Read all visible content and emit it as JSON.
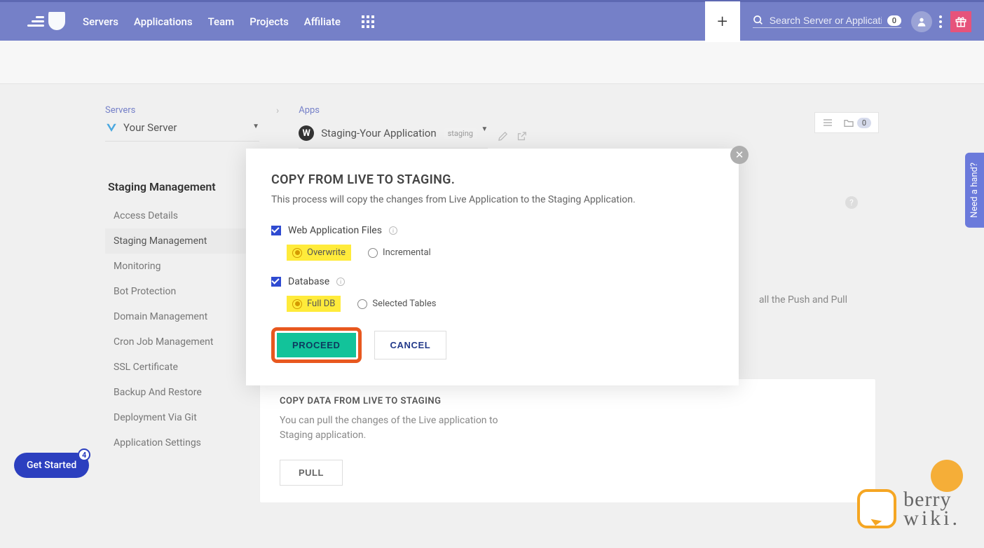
{
  "nav": {
    "links": [
      "Servers",
      "Applications",
      "Team",
      "Projects",
      "Affiliate"
    ],
    "search_placeholder": "Search Server or Application",
    "search_badge": "0"
  },
  "breadcrumb": {
    "servers_label": "Servers",
    "server_name": "Your Server",
    "apps_label": "Apps",
    "app_name": "Staging-Your Application",
    "app_tag": "staging"
  },
  "view_toggle_badge": "0",
  "sidebar": {
    "title": "Staging Management",
    "items": [
      {
        "label": "Access Details"
      },
      {
        "label": "Staging Management",
        "active": true
      },
      {
        "label": "Monitoring",
        "expandable": true
      },
      {
        "label": "Bot Protection"
      },
      {
        "label": "Domain Management"
      },
      {
        "label": "Cron Job Management"
      },
      {
        "label": "SSL Certificate"
      },
      {
        "label": "Backup And Restore"
      },
      {
        "label": "Deployment Via Git"
      },
      {
        "label": "Application Settings"
      }
    ]
  },
  "modal": {
    "title": "COPY FROM LIVE TO STAGING.",
    "desc": "This process will copy the changes from Live Application to the Staging Application.",
    "opt1_label": "Web Application Files",
    "opt1_radio1": "Overwrite",
    "opt1_radio2": "Incremental",
    "opt2_label": "Database",
    "opt2_radio1": "Full DB",
    "opt2_radio2": "Selected Tables",
    "proceed": "PROCEED",
    "cancel": "CANCEL"
  },
  "bg_panel": {
    "title": "COPY DATA FROM LIVE TO STAGING",
    "desc": "You can pull the changes of the Live application to Staging application.",
    "pull": "PULL",
    "right_text": "all the Push and Pull"
  },
  "widgets": {
    "get_started": "Get Started",
    "get_started_count": "4",
    "need_hand": "Need a hand?",
    "brand1": "berry",
    "brand2": "wiki."
  }
}
